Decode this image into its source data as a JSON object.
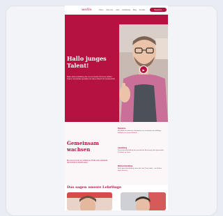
{
  "site": {
    "logo": "wellis",
    "nav": [
      "Home",
      "Über uns",
      "Jobs",
      "Ausbildung",
      "Blog",
      "Kontakt"
    ],
    "cta": "Bewerben"
  },
  "hero": {
    "title": "Hallo junges Talent!",
    "text": "Starte deine Ausbildung bei uns und werde Teil eines starken Teams. Gemeinsam gestalten wir deine Zukunft mit Leidenschaft.",
    "play_icon": "play-icon"
  },
  "section2": {
    "title": "Gemeinsam wachsen",
    "text": "Bei uns lernst du von erfahrenen Profis und entwickelst dich Schritt für Schritt weiter.",
    "info": [
      {
        "label": "Standorte",
        "text": "Wir bilden an mehreren Standorten aus und bieten dir vielfältige Einblicke in unseren Betrieb."
      },
      {
        "label": "Ausbildung",
        "text": "Praxisnahe Ausbildung mit persönlicher Betreuung und spannenden Projekten im Team."
      },
      {
        "label": "Weiterentwicklung",
        "text": "Nach deiner Ausbildung stehen dir viele Türen offen – wir fördern deine Karriere."
      }
    ]
  },
  "section3": {
    "title": "Das sagen unsere Lehrlinge"
  },
  "colors": {
    "brand": "#b5123f",
    "background": "#e9edf3"
  }
}
